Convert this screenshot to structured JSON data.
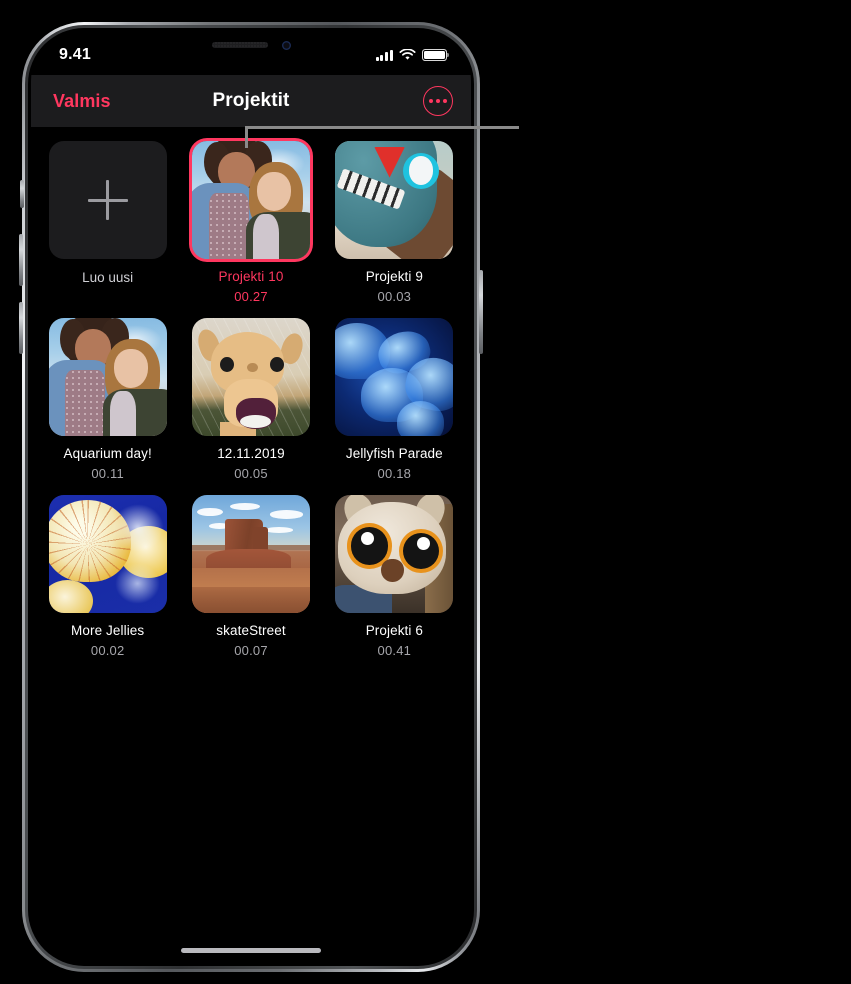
{
  "status_bar": {
    "time": "9.41",
    "cellular_icon": "signal-bars-icon",
    "wifi_icon": "wifi-icon",
    "battery_icon": "battery-full-icon"
  },
  "nav_bar": {
    "back_label": "Valmis",
    "title": "Projektit",
    "more_icon": "ellipsis-circle-icon",
    "accent_color": "#ff375f"
  },
  "new_project": {
    "label": "Luo uusi",
    "icon": "plus-icon"
  },
  "projects": [
    {
      "name": "Projekti 10",
      "duration": "00.27",
      "art": "art-girls",
      "selected": true
    },
    {
      "name": "Projekti 9",
      "duration": "00.03",
      "art": "art-robot",
      "selected": false
    },
    {
      "name": "Aquarium day!",
      "duration": "00.11",
      "art": "art-girls",
      "selected": false
    },
    {
      "name": "12.11.2019",
      "duration": "00.05",
      "art": "art-camel",
      "selected": false
    },
    {
      "name": "Jellyfish Parade",
      "duration": "00.18",
      "art": "art-jelly-blue",
      "selected": false
    },
    {
      "name": "More Jellies",
      "duration": "00.02",
      "art": "art-jelly-yellow",
      "selected": false
    },
    {
      "name": "skateStreet",
      "duration": "00.07",
      "art": "art-desert",
      "selected": false
    },
    {
      "name": "Projekti 6",
      "duration": "00.41",
      "art": "art-owl",
      "selected": false
    }
  ],
  "annotation": {
    "leader_line_color": "#8a8a8a"
  },
  "device": {
    "home_indicator": "home-indicator",
    "notch": "notch",
    "speaker": "earpiece-speaker",
    "front_camera": "front-camera"
  }
}
